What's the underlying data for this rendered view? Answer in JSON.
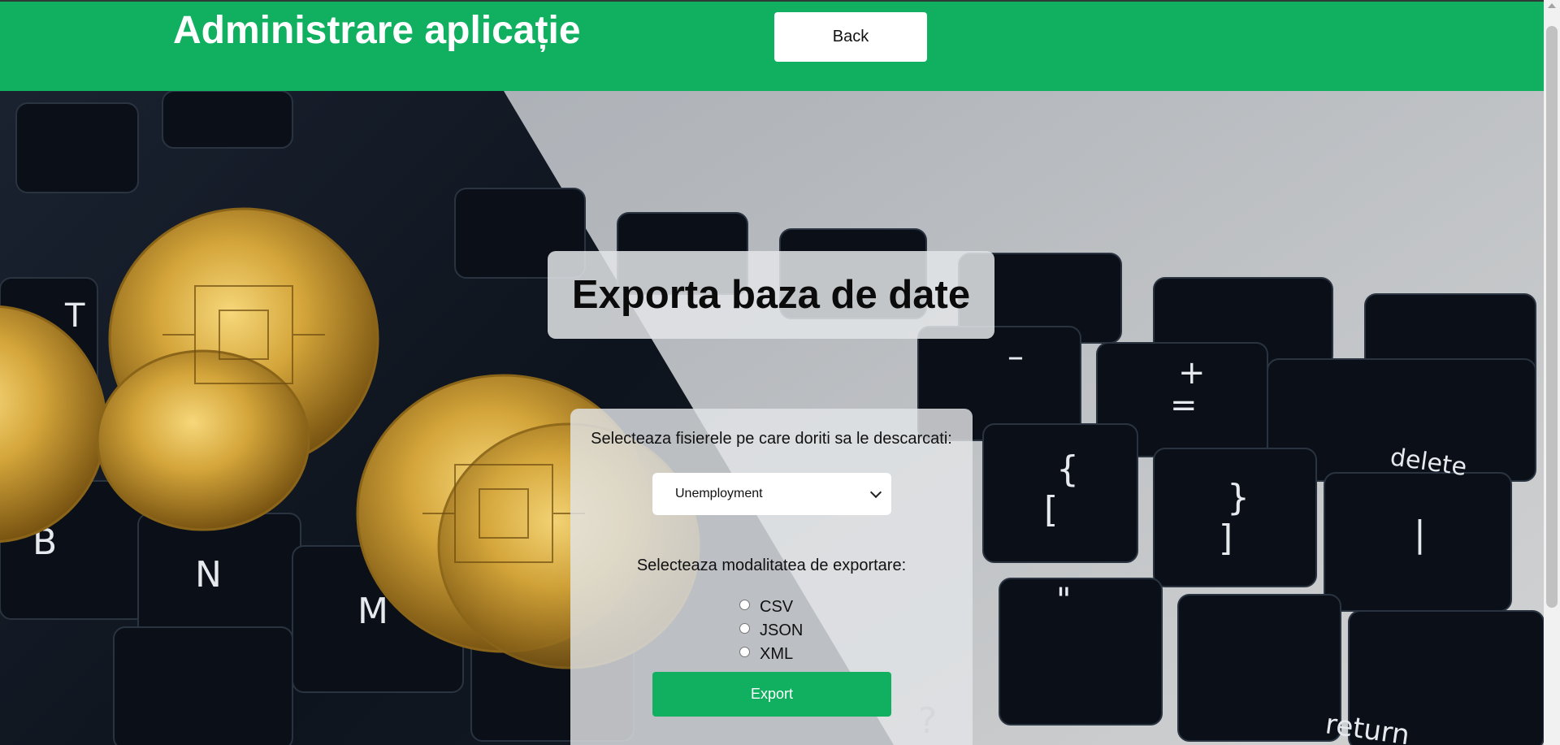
{
  "header": {
    "title": "Administrare aplicație",
    "back_label": "Back"
  },
  "export_title": "Exporta baza de date",
  "form": {
    "files_label": "Selecteaza fisierele pe care doriti sa le descarcati:",
    "selected_file": "Unemployment",
    "mode_label": "Selecteaza modalitatea de exportare:",
    "modes": [
      "CSV",
      "JSON",
      "XML"
    ],
    "export_label": "Export"
  },
  "colors": {
    "brand_green": "#10b060",
    "white": "#ffffff"
  }
}
